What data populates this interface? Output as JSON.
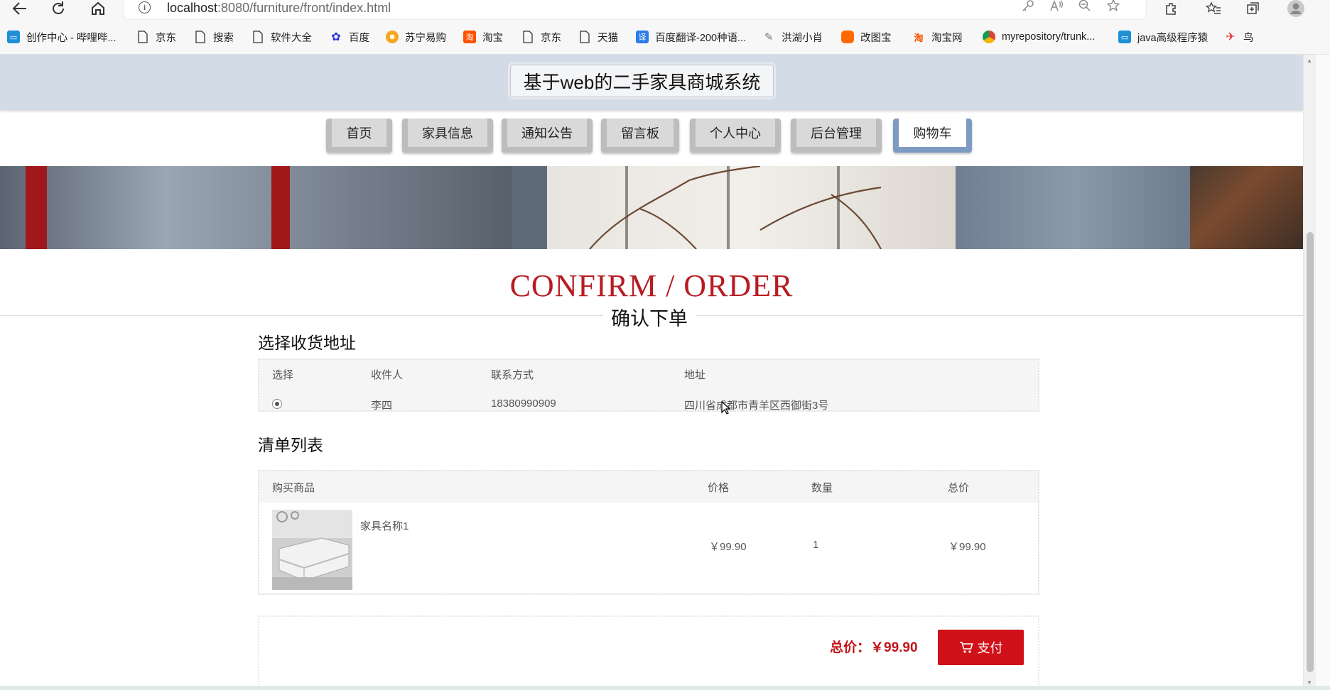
{
  "browser": {
    "url_host": "localhost",
    "url_rest": ":8080/furniture/front/index.html",
    "bookmarks": [
      {
        "label": "创作中心 - 哔哩哔...",
        "icon": "bilibili-icon",
        "color": "#1e90d6"
      },
      {
        "label": "京东",
        "icon": "page-icon"
      },
      {
        "label": "搜索",
        "icon": "page-icon"
      },
      {
        "label": "软件大全",
        "icon": "page-icon"
      },
      {
        "label": "百度",
        "icon": "baidu-paw-icon",
        "color": "#2932e1"
      },
      {
        "label": "苏宁易购",
        "icon": "suning-icon",
        "color": "#f5a623"
      },
      {
        "label": "淘宝",
        "icon": "taobao-icon",
        "color": "#ff5000"
      },
      {
        "label": "京东",
        "icon": "page-icon"
      },
      {
        "label": "天猫",
        "icon": "page-icon"
      },
      {
        "label": "百度翻译-200种语...",
        "icon": "translate-icon",
        "color": "#2b7de9"
      },
      {
        "label": "洪湖小肖",
        "icon": "feather-icon",
        "color": "#777777"
      },
      {
        "label": "改图宝",
        "icon": "gaitubao-icon",
        "color": "#ff6a00"
      },
      {
        "label": "淘宝网",
        "icon": "taobao-icon",
        "color": "#ff5000"
      },
      {
        "label": "myrepository/trunk...",
        "icon": "chrome-icon",
        "color": "#db4437"
      },
      {
        "label": "java高级程序猿",
        "icon": "bilibili-icon",
        "color": "#1e90d6"
      },
      {
        "label": "鸟",
        "icon": "bird-icon",
        "color": "#e53935"
      }
    ]
  },
  "site": {
    "title": "基于web的二手家具商城系统",
    "menu": [
      {
        "label": "首页",
        "active": false
      },
      {
        "label": "家具信息",
        "active": false
      },
      {
        "label": "通知公告",
        "active": false
      },
      {
        "label": "留言板",
        "active": false
      },
      {
        "label": "个人中心",
        "active": false
      },
      {
        "label": "后台管理",
        "active": false
      },
      {
        "label": "购物车",
        "active": true
      }
    ]
  },
  "confirm": {
    "title": "CONFIRM / ORDER",
    "subtitle": "确认下单"
  },
  "address": {
    "section_title": "选择收货地址",
    "headers": {
      "select": "选择",
      "receiver": "收件人",
      "phone": "联系方式",
      "address": "地址"
    },
    "row": {
      "selected": true,
      "receiver": "李四",
      "phone": "18380990909",
      "address": "四川省成都市青羊区西御街3号"
    }
  },
  "items": {
    "section_title": "清单列表",
    "headers": {
      "product": "购买商品",
      "price": "价格",
      "quantity": "数量",
      "total": "总价"
    },
    "rows": [
      {
        "name": "家具名称1",
        "price": "￥99.90",
        "quantity": "1",
        "total": "￥99.90"
      }
    ]
  },
  "summary": {
    "total_label": "总价：￥99.90",
    "pay_label": "支付"
  },
  "colors": {
    "accent": "#d0111a",
    "header_bg": "#d3dce6",
    "title_red": "#b81c22"
  }
}
